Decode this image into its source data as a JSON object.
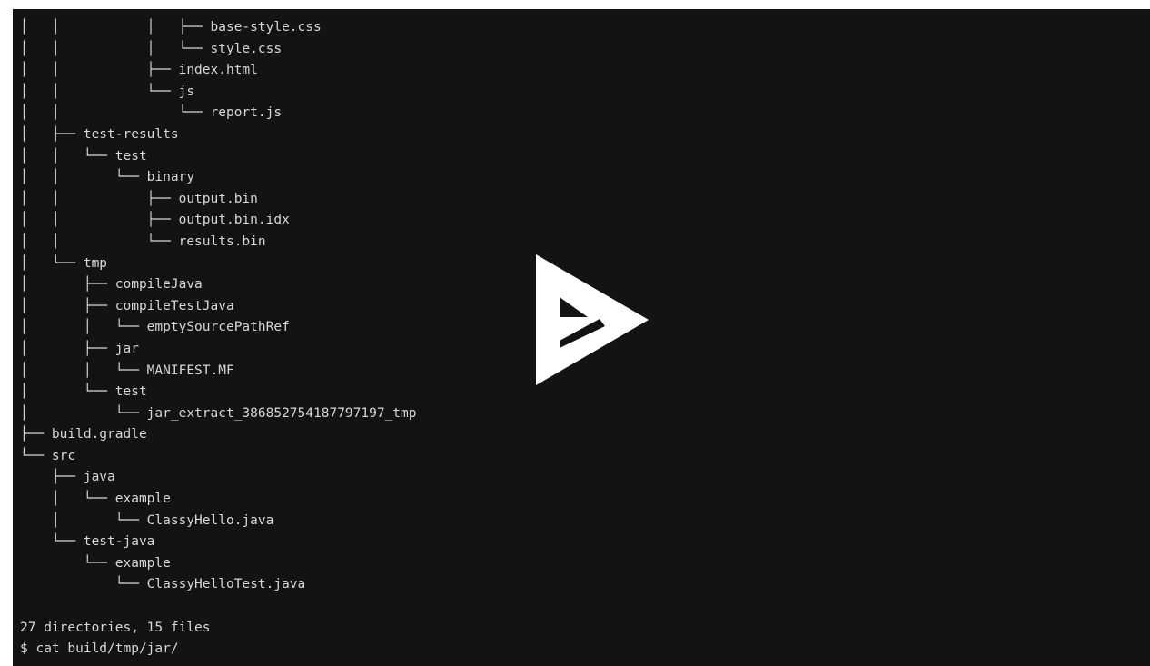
{
  "terminal": {
    "tree_lines": [
      "│   │           │   ├── base-style.css",
      "│   │           │   └── style.css",
      "│   │           ├── index.html",
      "│   │           └── js",
      "│   │               └── report.js",
      "│   ├── test-results",
      "│   │   └── test",
      "│   │       └── binary",
      "│   │           ├── output.bin",
      "│   │           ├── output.bin.idx",
      "│   │           └── results.bin",
      "│   └── tmp",
      "│       ├── compileJava",
      "│       ├── compileTestJava",
      "│       │   └── emptySourcePathRef",
      "│       ├── jar",
      "│       │   └── MANIFEST.MF",
      "│       └── test",
      "│           └── jar_extract_386852754187797197_tmp",
      "├── build.gradle",
      "└── src",
      "    ├── java",
      "    │   └── example",
      "    │       └── ClassyHello.java",
      "    └── test-java",
      "        └── example",
      "            └── ClassyHelloTest.java",
      ""
    ],
    "summary": "27 directories, 15 files",
    "prompt": "$ cat build/tmp/jar/"
  },
  "player": {
    "play_icon": "asciinema-play-icon",
    "icon_color": "#ffffff",
    "background_color": "#121314",
    "text_color": "#d8d8d8"
  }
}
